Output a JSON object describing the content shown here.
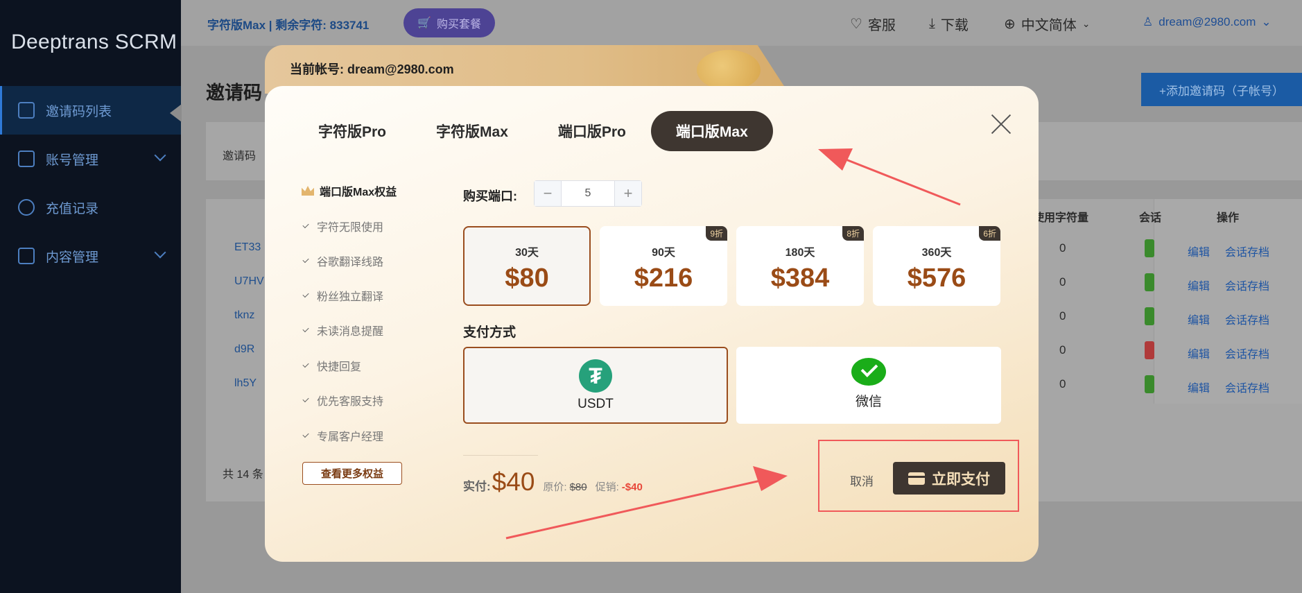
{
  "sidebar": {
    "logo": "Deeptrans SCRM",
    "items": [
      {
        "label": "邀请码列表",
        "active": true
      },
      {
        "label": "账号管理",
        "expandable": true
      },
      {
        "label": "充值记录"
      },
      {
        "label": "内容管理",
        "expandable": true
      }
    ]
  },
  "topbar": {
    "plan_info": "字符版Max  |  剩余字符: 833741",
    "buy_label": "购买套餐",
    "support": "客服",
    "download": "下载",
    "language": "中文简体",
    "account": "dream@2980.com"
  },
  "page": {
    "title": "邀请码",
    "add_button": "+添加邀请码（子帐号）",
    "filter_label": "邀请码",
    "columns": {
      "used_chars": "使用字符量",
      "session": "会话",
      "ops": "操作"
    },
    "rows": [
      {
        "code": "ET33",
        "used": "0",
        "status_color": "#3a8a2c"
      },
      {
        "code": "U7HV",
        "used": "0",
        "status_color": "#3a8a2c"
      },
      {
        "code": "tknz",
        "used": "0",
        "status_color": "#3a8a2c"
      },
      {
        "code": "d9R",
        "used": "0",
        "status_color": "#b03a3a"
      },
      {
        "code": "lh5Y",
        "used": "0",
        "status_color": "#3a8a2c"
      }
    ],
    "row_edit": "编辑",
    "row_archive": "会话存档",
    "total": "共 14 条"
  },
  "modal": {
    "account": "当前帐号: dream@2980.com",
    "tabs": [
      "字符版Pro",
      "字符版Max",
      "端口版Pro",
      "端口版Max"
    ],
    "active_tab": 3,
    "benefits_title": "端口版Max权益",
    "benefits": [
      "字符无限使用",
      "谷歌翻译线路",
      "粉丝独立翻译",
      "未读消息提醒",
      "快捷回复",
      "优先客服支持",
      "专属客户经理"
    ],
    "more_benefits": "查看更多权益",
    "qty_label": "购买端口:",
    "qty_value": "5",
    "qty_minus": "−",
    "qty_plus": "+",
    "plans": [
      {
        "days": "30天",
        "price": "$80",
        "badge": ""
      },
      {
        "days": "90天",
        "price": "$216",
        "badge": "9折"
      },
      {
        "days": "180天",
        "price": "$384",
        "badge": "8折"
      },
      {
        "days": "360天",
        "price": "$576",
        "badge": "6折"
      }
    ],
    "selected_plan": 0,
    "pay_label": "支付方式",
    "pay_methods": [
      {
        "label": "USDT",
        "icon": "tether-icon"
      },
      {
        "label": "微信",
        "icon": "wechat-icon"
      }
    ],
    "selected_pay": 0,
    "paid_label": "实付:",
    "paid_value": "$40",
    "orig_label": "原价:",
    "orig_value": "$80",
    "promo_label": "促销:",
    "promo_value": "-$40",
    "cancel": "取消",
    "pay_now": "立即支付"
  },
  "colors": {
    "accent_dark": "#3e3630",
    "price": "#9a4b16",
    "annotation": "#f0595a"
  }
}
